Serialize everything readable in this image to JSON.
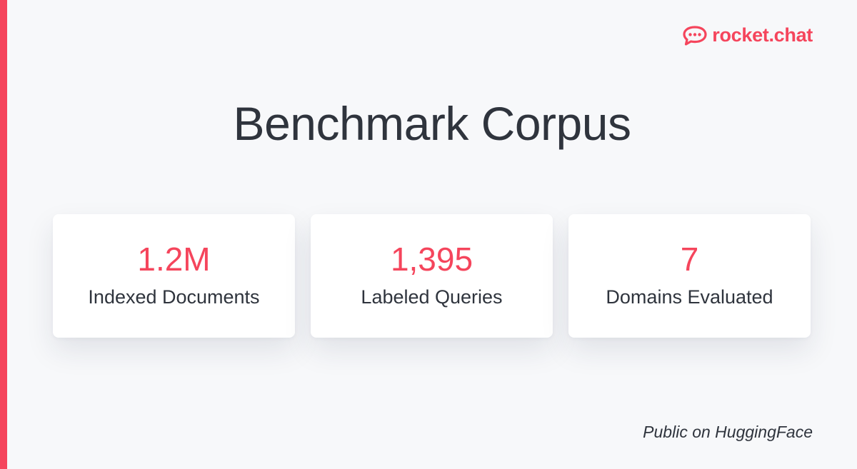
{
  "brand": {
    "name": "rocket.chat",
    "accent_color": "#f5455c",
    "logo_icon": "chat-bubble-icon"
  },
  "title": "Benchmark Corpus",
  "stats": [
    {
      "value": "1.2M",
      "label": "Indexed Documents"
    },
    {
      "value": "1,395",
      "label": "Labeled Queries"
    },
    {
      "value": "7",
      "label": "Domains Evaluated"
    }
  ],
  "footnote": "Public on HuggingFace"
}
